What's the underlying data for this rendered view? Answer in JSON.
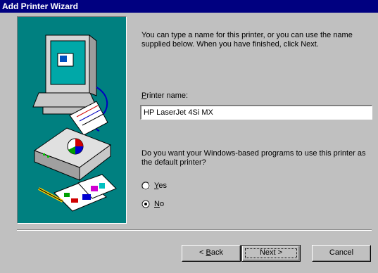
{
  "window": {
    "title": "Add Printer Wizard"
  },
  "instructions": "You can type a name for this printer, or you can use the name supplied below. When you have finished, click Next.",
  "printer_name": {
    "label_first": "P",
    "label_rest": "rinter name:",
    "value": "HP LaserJet 4Si MX"
  },
  "default_question": "Do you want your Windows-based programs to use this printer as the default printer?",
  "options": [
    {
      "label_first": "Y",
      "label_rest": "es",
      "selected": false
    },
    {
      "label_first": "N",
      "label_rest": "o",
      "selected": true
    }
  ],
  "buttons": {
    "back": {
      "prefix": "< ",
      "first": "B",
      "rest": "ack"
    },
    "next": "Next >",
    "cancel": "Cancel"
  }
}
